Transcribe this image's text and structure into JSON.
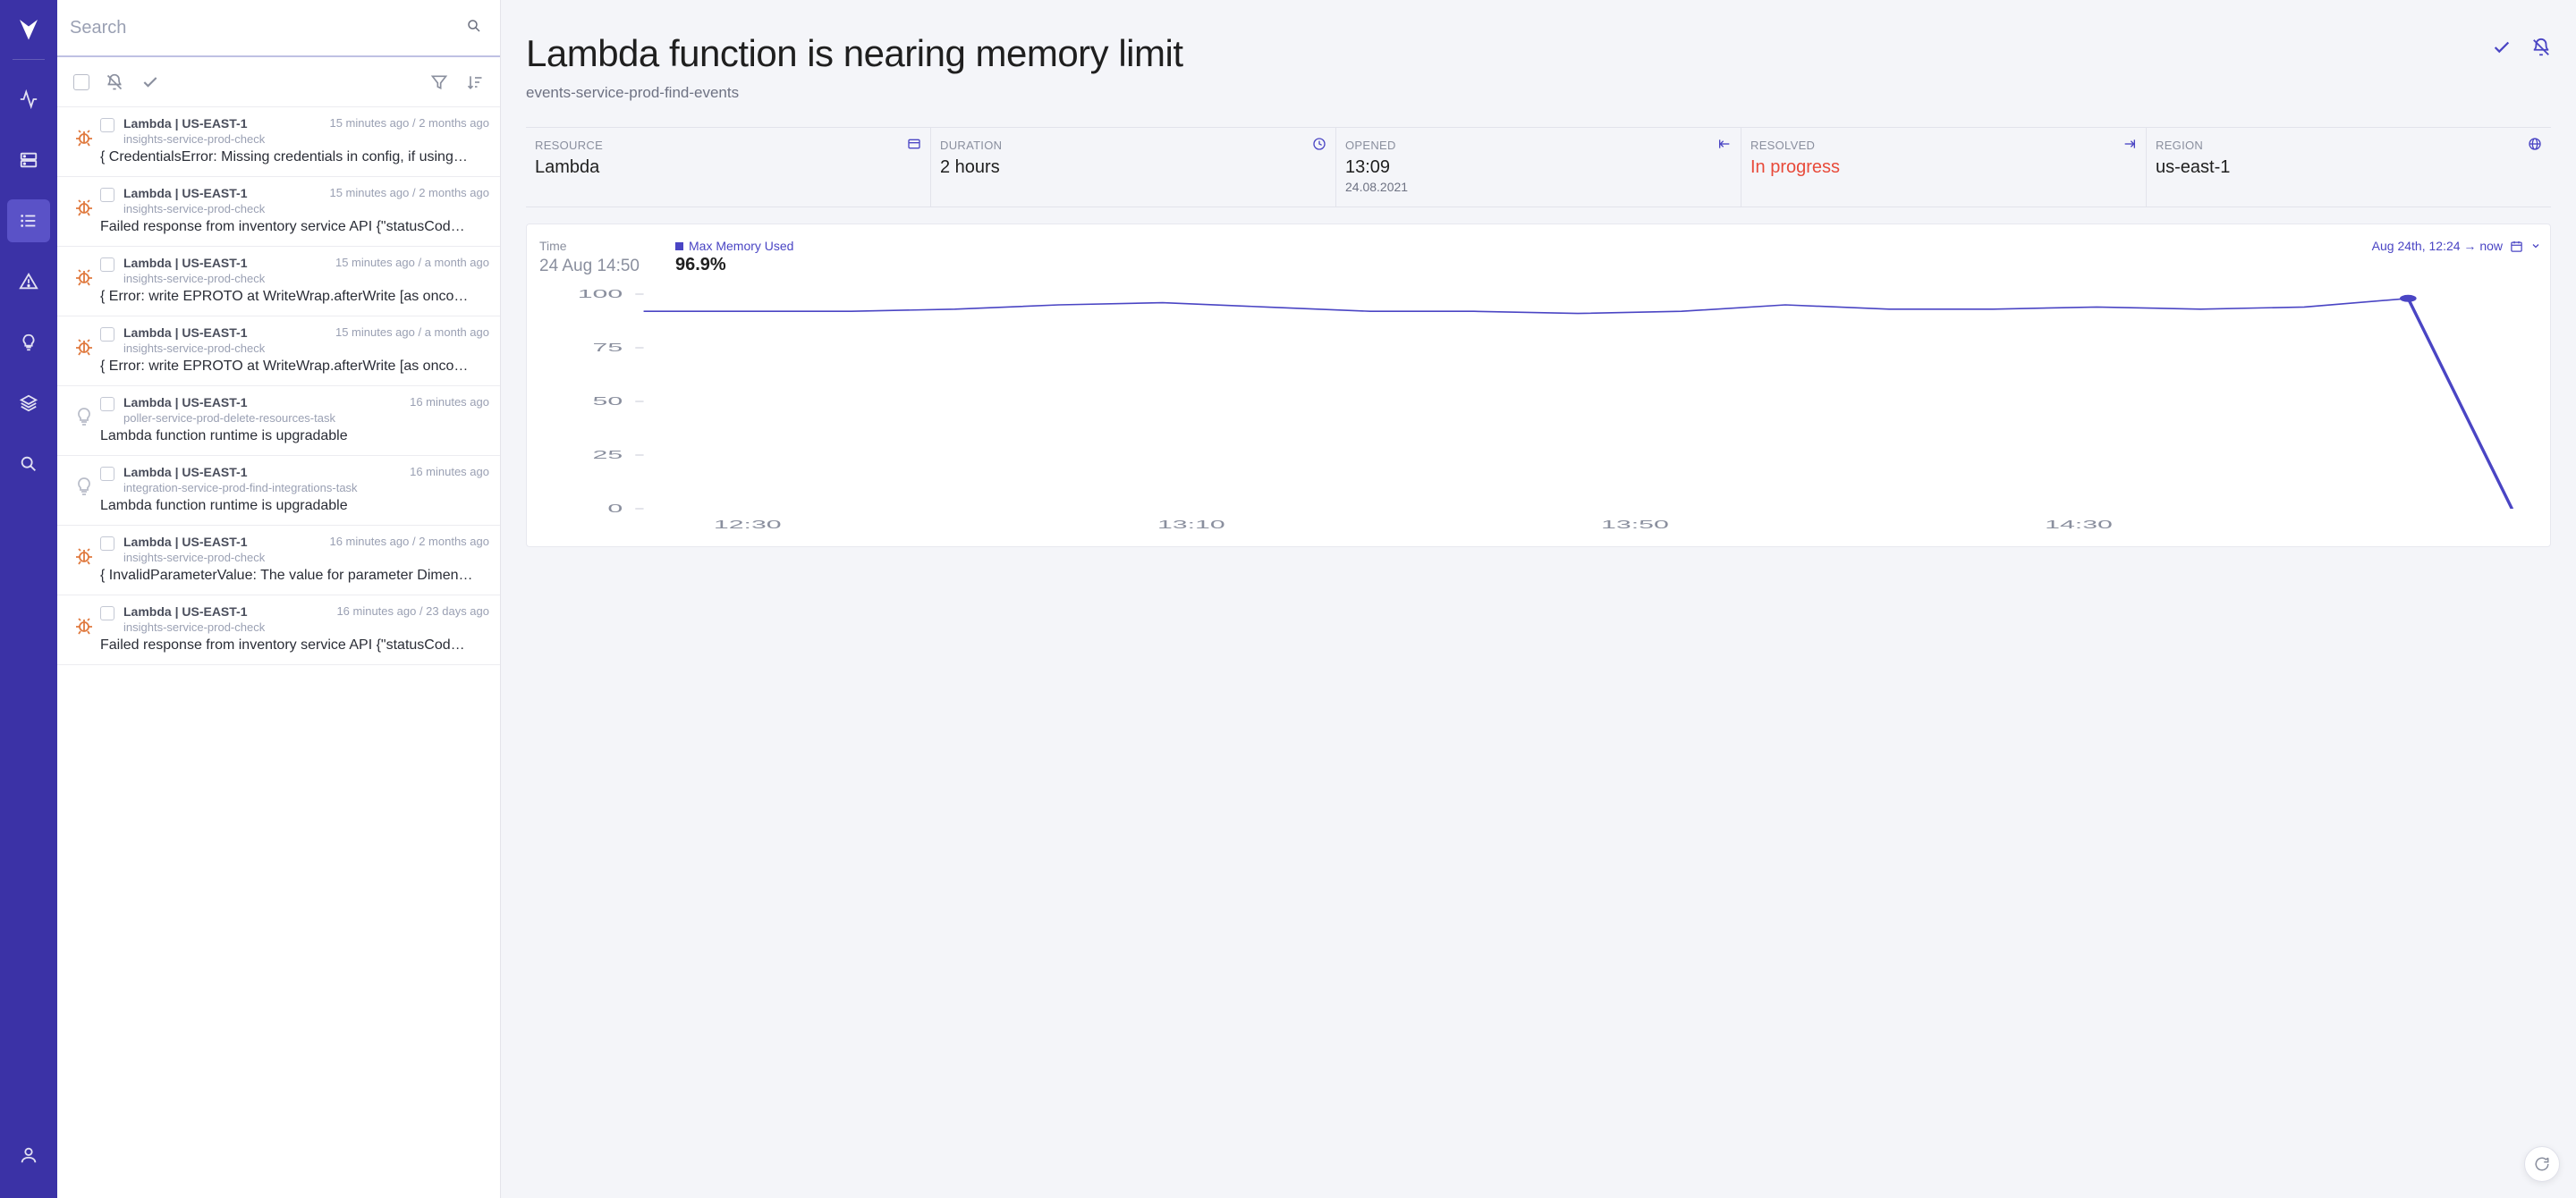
{
  "search": {
    "placeholder": "Search"
  },
  "issues": [
    {
      "kind": "bug",
      "meta": "Lambda | US-EAST-1",
      "time": "15 minutes ago / 2 months ago",
      "service": "insights-service-prod-check",
      "title": "{ CredentialsError: Missing credentials in config, if using…"
    },
    {
      "kind": "bug",
      "meta": "Lambda | US-EAST-1",
      "time": "15 minutes ago / 2 months ago",
      "service": "insights-service-prod-check",
      "title": "Failed response from inventory service API {\"statusCod…"
    },
    {
      "kind": "bug",
      "meta": "Lambda | US-EAST-1",
      "time": "15 minutes ago / a month ago",
      "service": "insights-service-prod-check",
      "title": "{ Error: write EPROTO at WriteWrap.afterWrite [as onco…"
    },
    {
      "kind": "bug",
      "meta": "Lambda | US-EAST-1",
      "time": "15 minutes ago / a month ago",
      "service": "insights-service-prod-check",
      "title": "{ Error: write EPROTO at WriteWrap.afterWrite [as onco…"
    },
    {
      "kind": "tip",
      "meta": "Lambda | US-EAST-1",
      "time": "16 minutes ago",
      "service": "poller-service-prod-delete-resources-task",
      "title": "Lambda function runtime is upgradable"
    },
    {
      "kind": "tip",
      "meta": "Lambda | US-EAST-1",
      "time": "16 minutes ago",
      "service": "integration-service-prod-find-integrations-task",
      "title": "Lambda function runtime is upgradable"
    },
    {
      "kind": "bug",
      "meta": "Lambda | US-EAST-1",
      "time": "16 minutes ago / 2 months ago",
      "service": "insights-service-prod-check",
      "title": "{ InvalidParameterValue: The value for parameter Dimen…"
    },
    {
      "kind": "bug",
      "meta": "Lambda | US-EAST-1",
      "time": "16 minutes ago / 23 days ago",
      "service": "insights-service-prod-check",
      "title": "Failed response from inventory service API {\"statusCod…"
    }
  ],
  "detail": {
    "title": "Lambda function is nearing memory limit",
    "subtitle": "events-service-prod-find-events",
    "info": {
      "resource": {
        "label": "RESOURCE",
        "value": "Lambda"
      },
      "duration": {
        "label": "DURATION",
        "value": "2 hours"
      },
      "opened": {
        "label": "OPENED",
        "value": "13:09",
        "sub": "24.08.2021"
      },
      "resolved": {
        "label": "RESOLVED",
        "value": "In progress"
      },
      "region": {
        "label": "REGION",
        "value": "us-east-1"
      }
    },
    "chart": {
      "timeLabel": "Time",
      "time": "24 Aug 14:50",
      "legend": "Max Memory Used",
      "value": "96.9%",
      "range": "Aug 24th, 12:24 → now"
    }
  },
  "chart_data": {
    "type": "line",
    "title": "",
    "xlabel": "",
    "ylabel": "",
    "ylim": [
      0,
      100
    ],
    "y_ticks": [
      0,
      25,
      50,
      75,
      100
    ],
    "x_ticks": [
      "12:30",
      "13:10",
      "13:50",
      "14:30"
    ],
    "series": [
      {
        "name": "Max Memory Used",
        "color": "#4a45c4",
        "x": [
          "12:24",
          "12:30",
          "12:40",
          "12:50",
          "13:00",
          "13:10",
          "13:20",
          "13:30",
          "13:40",
          "13:50",
          "14:00",
          "14:10",
          "14:20",
          "14:30",
          "14:40",
          "14:50",
          "15:00",
          "15:02",
          "15:03"
        ],
        "values": [
          92,
          92,
          92,
          93,
          95,
          96,
          94,
          92,
          92,
          91,
          92,
          95,
          93,
          93,
          94,
          93,
          94,
          98,
          0
        ]
      }
    ],
    "highlight_point": {
      "x": "15:02",
      "value": 98
    }
  }
}
